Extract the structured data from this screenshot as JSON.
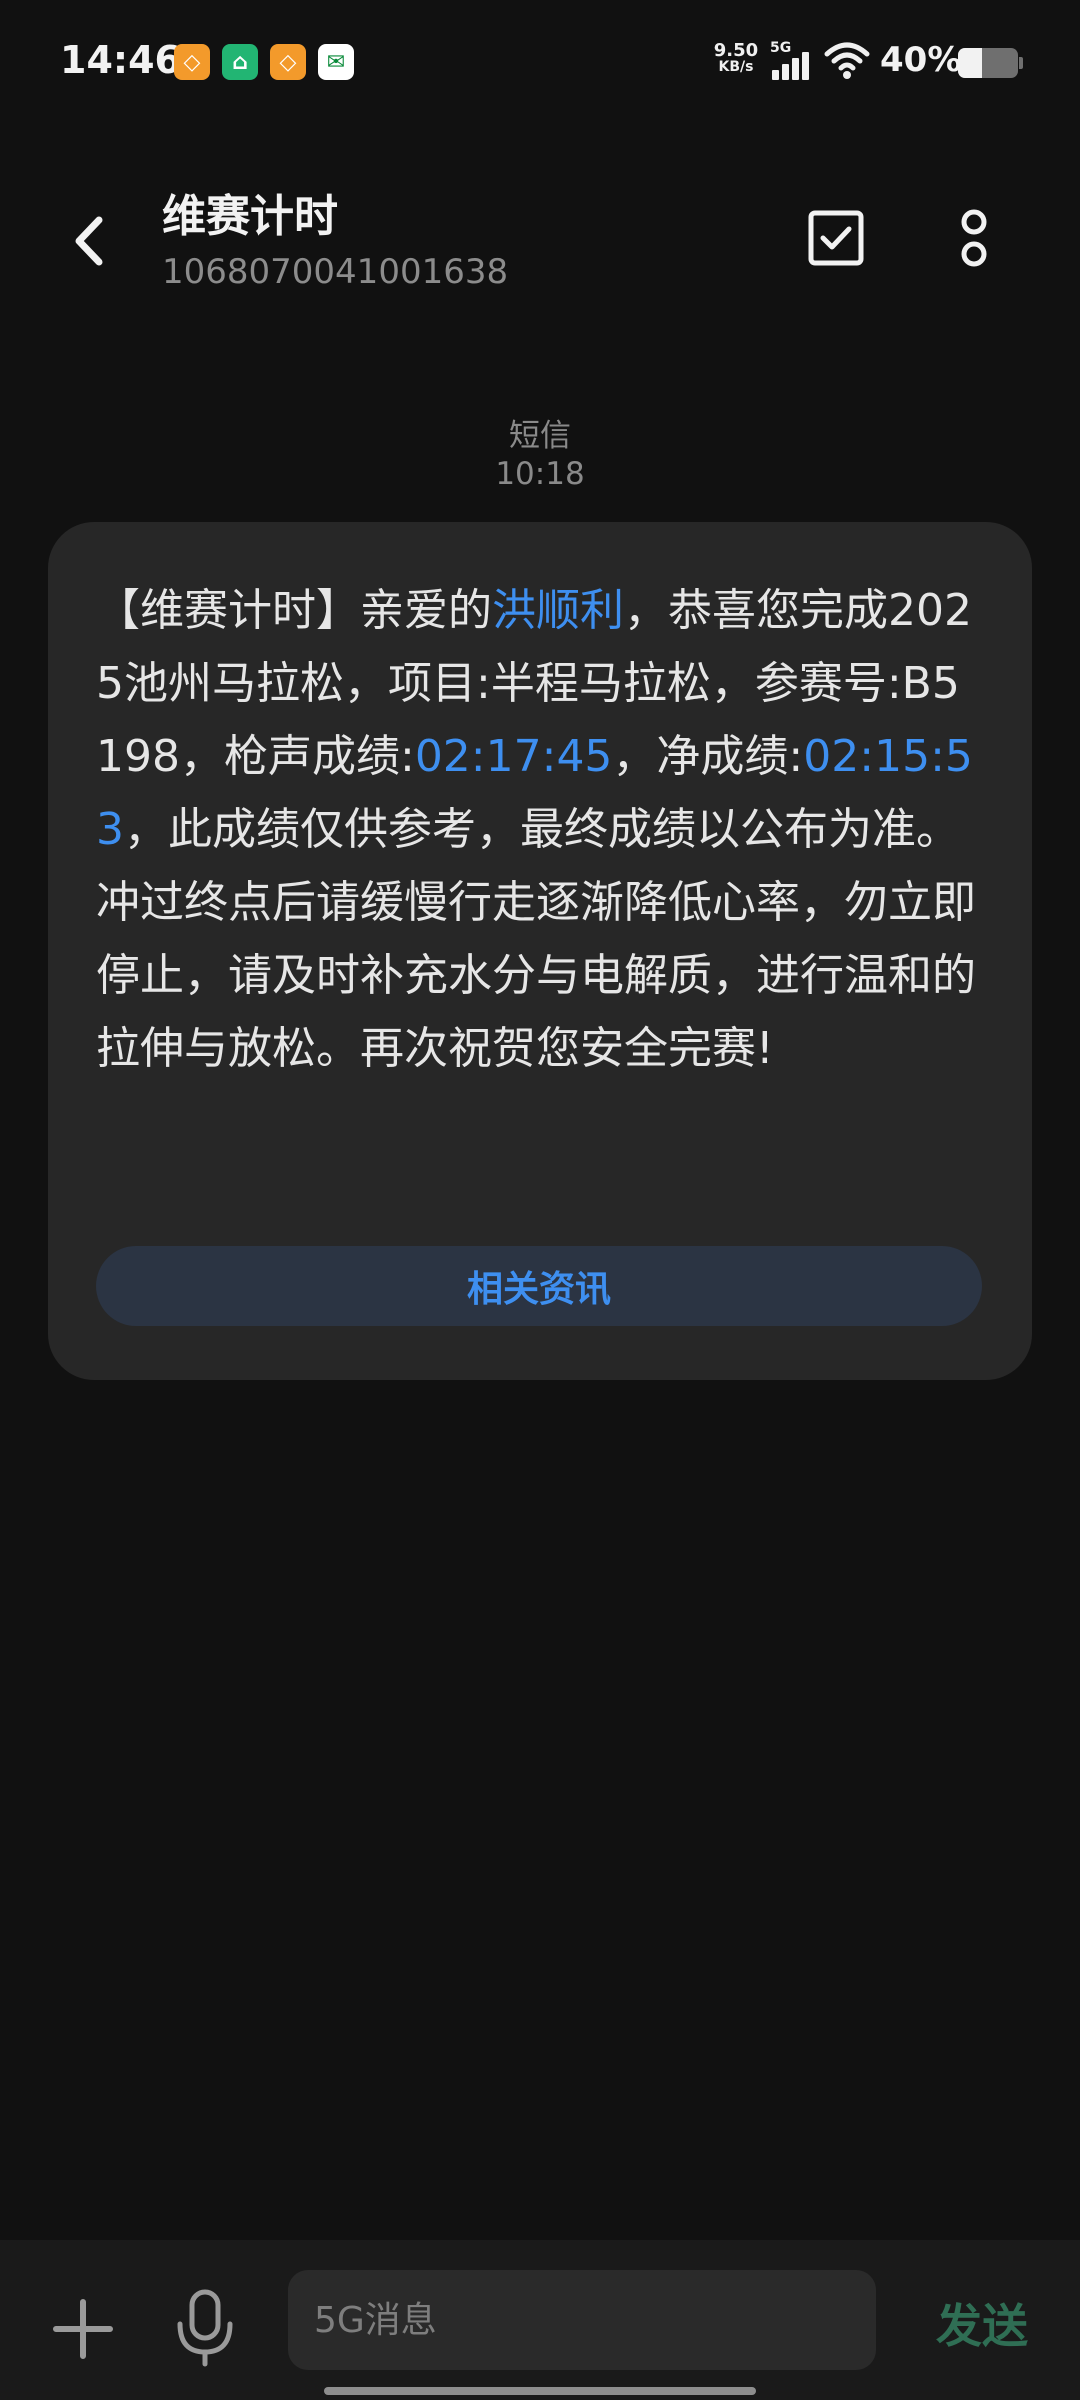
{
  "status_bar": {
    "time": "14:46",
    "notification_icons": [
      "taobao-icon",
      "mi-icon",
      "taobao-icon",
      "post-icon"
    ],
    "net_speed_value": "9.50",
    "net_speed_unit": "KB/s",
    "network_type": "5G",
    "battery_percent_text": "40%",
    "battery_level": 0.4
  },
  "header": {
    "contact_name": "维赛计时",
    "contact_number": "1068070041001638"
  },
  "conversation": {
    "message_type": "短信",
    "message_time": "10:18",
    "message": {
      "seg1": "【维赛计时】亲爱的",
      "name": "洪顺利",
      "seg2": "，恭喜您完成2025池州马拉松，项目:半程马拉松，参赛号:B5198，枪声成绩:",
      "gun_time": "02:17:45",
      "seg3": "，净成绩:",
      "net_time": "02:15:53",
      "seg4": "，此成绩仅供参考，最终成绩以公布为准。冲过终点后请缓慢行走逐渐降低心率，勿立即停止，请及时补充水分与电解质，进行温和的拉伸与放松。再次祝贺您安全完赛!"
    },
    "related_button_label": "相关资讯"
  },
  "input_bar": {
    "placeholder": "5G消息",
    "send_label": "发送"
  },
  "colors": {
    "background": "#111111",
    "bubble": "#272727",
    "accent_blue": "#3e8ff0",
    "send_green": "#2f6e54"
  }
}
